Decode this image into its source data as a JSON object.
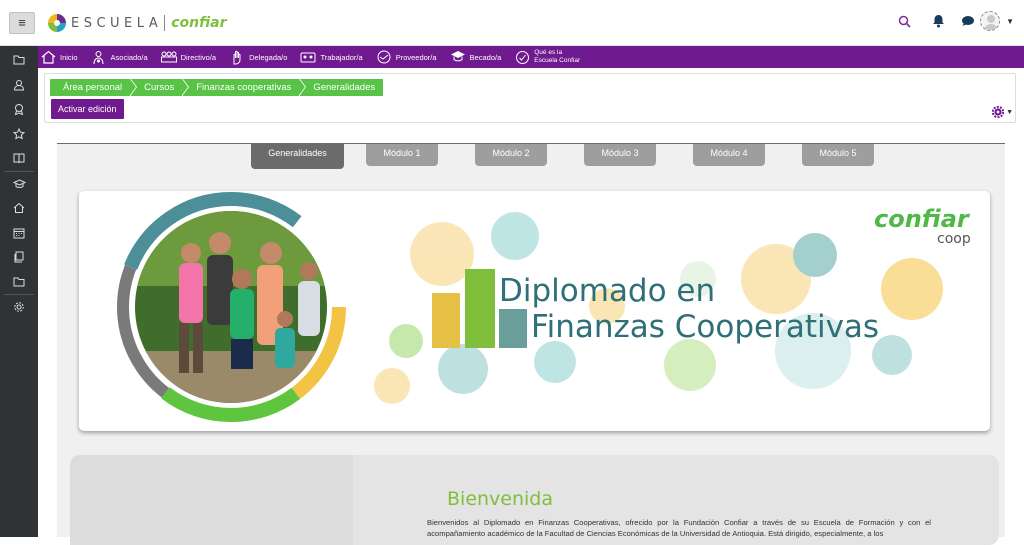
{
  "topbar": {
    "logo_word": "ESCUELA",
    "logo_brand": "confiar"
  },
  "menu": {
    "items": [
      {
        "label": "Inicio",
        "icon": "home-icon"
      },
      {
        "label": "Asociado/a",
        "icon": "associate-icon"
      },
      {
        "label": "Directivo/a",
        "icon": "directors-icon"
      },
      {
        "label": "Delegada/o",
        "icon": "hand-icon"
      },
      {
        "label": "Trabajador/a",
        "icon": "worker-icon"
      },
      {
        "label": "Proveedor/a",
        "icon": "handshake-icon"
      },
      {
        "label": "Becado/a",
        "icon": "graduate-icon"
      },
      {
        "label_line1": "Qué es la",
        "label_line2": "Escuela Confiar",
        "icon": "school-icon"
      }
    ]
  },
  "breadcrumb": [
    "Área personal",
    "Cursos",
    "Finanzas cooperativas",
    "Generalidades"
  ],
  "edit_button": "Activar edición",
  "tabs": [
    "Generalidades",
    "Módulo 1",
    "Módulo 2",
    "Módulo 3",
    "Módulo 4",
    "Módulo 5"
  ],
  "banner": {
    "title_line1": "Diplomado en",
    "title_line2": "Finanzas Cooperativas",
    "brand": "confiar",
    "brand_sub": "coop"
  },
  "welcome": {
    "title": "Bienvenida",
    "text": "Bienvenidos al Diplomado en Finanzas Cooperativas, ofrecido por la Fundación Confiar a través de su Escuela de Formación y con el acompañamiento académico de la Facultad de Ciencias Económicas de la Universidad de Antioquia. Está dirigido, especialmente, a los"
  },
  "colors": {
    "purple": "#6f1a8e",
    "green": "#58c347",
    "rail": "#2f3336"
  }
}
